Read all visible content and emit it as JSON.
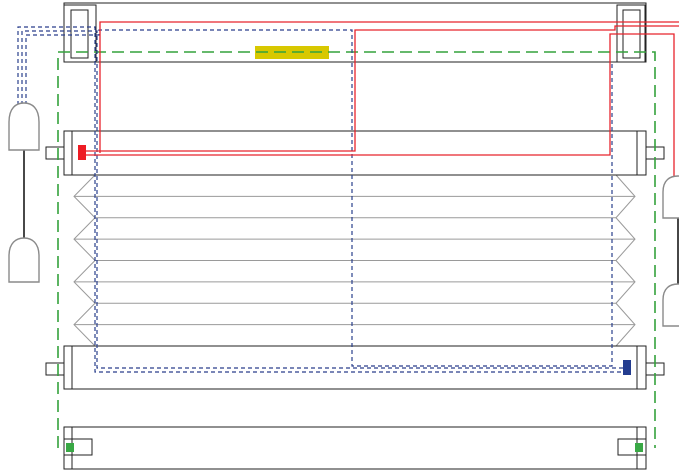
{
  "diagram": {
    "type": "pleated-blind-cord-schematic",
    "components": [
      "headrail",
      "upper-movable-rail",
      "pleated-fabric",
      "lower-movable-rail",
      "bottom-rail",
      "left-handle-pair",
      "right-handle-pair"
    ],
    "pleat_folds": 4,
    "colors": {
      "red_cord": "#e8242c",
      "blue_cord": "#2a3f8c",
      "green_cord": "#34a23c",
      "yellow_marker": "#d8c800",
      "red_block": "#ee1c24",
      "blue_block": "#233c8f",
      "green_block": "#39a845",
      "outline": "#222222",
      "pleat_line": "#9a9a9a",
      "handle_outline": "#8a8a8a",
      "handle_cord": "#333333"
    }
  }
}
